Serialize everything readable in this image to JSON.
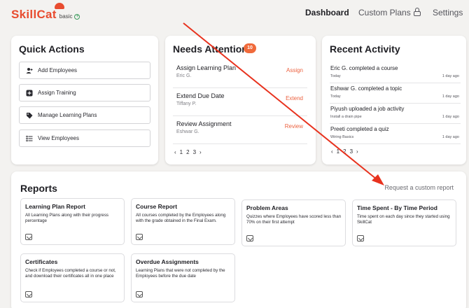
{
  "header": {
    "logo_text": "SkillCat",
    "plan_tier": "basic",
    "nav": [
      {
        "label": "Dashboard"
      },
      {
        "label": "Custom Plans"
      },
      {
        "label": "Settings"
      }
    ]
  },
  "quick_actions": {
    "title": "Quick Actions",
    "buttons": [
      {
        "label": "Add Employees",
        "icon": "add-user-icon"
      },
      {
        "label": "Assign Training",
        "icon": "plus-square-icon"
      },
      {
        "label": "Manage Learning Plans",
        "icon": "tag-icon"
      },
      {
        "label": "View Employees",
        "icon": "list-icon"
      }
    ]
  },
  "needs_attention": {
    "title": "Needs Attention",
    "count": "10",
    "items": [
      {
        "title": "Assign Learning Plan",
        "subtitle": "Eric G.",
        "action": "Assign"
      },
      {
        "title": "Extend Due Date",
        "subtitle": "Tiffany P.",
        "action": "Extend"
      },
      {
        "title": "Review Assignment",
        "subtitle": "Eshwar G.",
        "action": "Review"
      }
    ],
    "pager": {
      "prev": "‹",
      "pages": [
        "1",
        "2",
        "3"
      ],
      "next": "›"
    }
  },
  "recent_activity": {
    "title": "Recent Activity",
    "items": [
      {
        "title": "Eric G. completed a course",
        "subtitle": "Today",
        "date": "1 day ago"
      },
      {
        "title": "Eshwar G. completed a topic",
        "subtitle": "Today",
        "date": "1 day ago"
      },
      {
        "title": "Piyush uploaded a job activity",
        "subtitle": "Install a drain pipe",
        "date": "1 day ago"
      },
      {
        "title": "Preeti completed a quiz",
        "subtitle": "Wiring Basics",
        "date": "1 day ago"
      }
    ],
    "pager": {
      "prev": "‹",
      "pages": [
        "1",
        "2",
        "3"
      ],
      "next": "›"
    }
  },
  "reports": {
    "title": "Reports",
    "request_link": "Request a custom report",
    "cards": [
      {
        "title": "Learning Plan Report",
        "desc": "All Learning Plans along with their progress percentage"
      },
      {
        "title": "Course Report",
        "desc": "All courses completed by the Employees along with the grade obtained in the Final Exam."
      },
      {
        "title": "Problem Areas",
        "desc": "Quizzes where Employees have scored less than 70% on their first attempt"
      },
      {
        "title": "Time Spent - By Time Period",
        "desc": "Time spent on each day since they started using SkillCat"
      },
      {
        "title": "Certificates",
        "desc": "Check if Employees completed a course or not, and download their certificates all in one place"
      },
      {
        "title": "Overdue Assignments",
        "desc": "Learning Plans that were not completed by the Employees before the due date"
      }
    ]
  },
  "colors": {
    "accent": "#e84c2f",
    "action": "#ec6240",
    "annotation_arrow": "#e8321e"
  }
}
